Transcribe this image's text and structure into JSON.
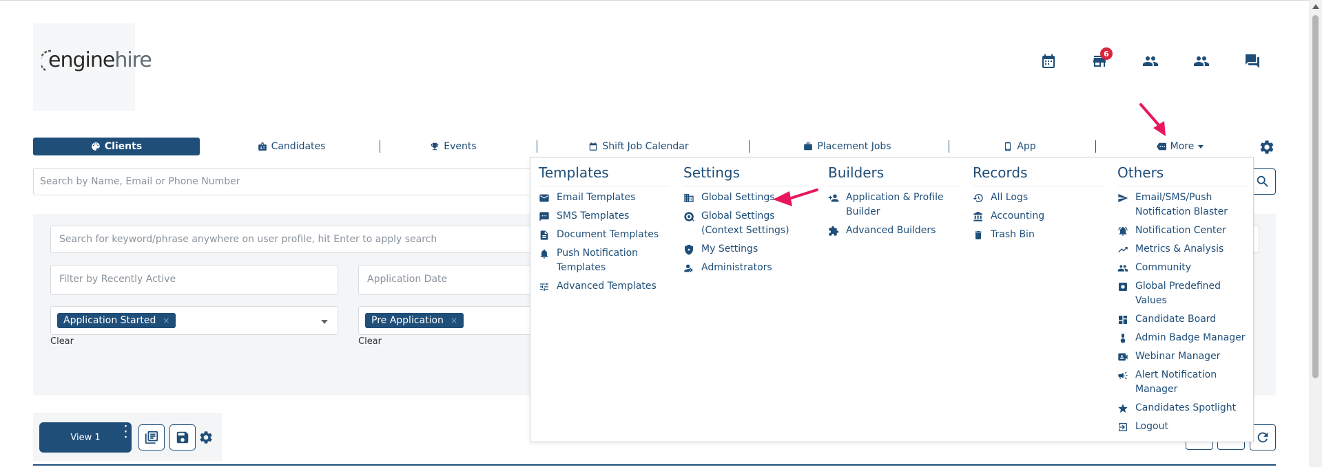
{
  "logo": {
    "text_a": "engine",
    "text_b": "hire"
  },
  "header_icons": [
    {
      "name": "calendar-icon"
    },
    {
      "name": "store-icon",
      "badge": "6"
    },
    {
      "name": "people-icon"
    },
    {
      "name": "group-icon"
    },
    {
      "name": "chat-icon"
    }
  ],
  "nav": {
    "tabs": [
      {
        "label": "Clients",
        "icon": "palette-icon",
        "active": true
      },
      {
        "label": "Candidates",
        "icon": "badge-icon"
      },
      {
        "label": "Events",
        "icon": "trophy-icon"
      },
      {
        "label": "Shift Job Calendar",
        "icon": "calendar-icon"
      },
      {
        "label": "Placement Jobs",
        "icon": "briefcase-icon"
      },
      {
        "label": "App",
        "icon": "phone-icon"
      },
      {
        "label": "More",
        "icon": "more-icon"
      }
    ]
  },
  "search": {
    "placeholder": "Search by Name, Email or Phone Number"
  },
  "filters": {
    "keyword_placeholder": "Search for keyword/phrase anywhere on user profile, hit Enter to apply search",
    "recent_placeholder": "Filter by Recently Active",
    "app_date_placeholder": "Application Date",
    "chip1": "Application Started",
    "chip2": "Pre Application",
    "clear1": "Clear",
    "clear2": "Clear"
  },
  "views": {
    "view1": "View 1"
  },
  "menu": {
    "templates": {
      "title": "Templates",
      "items": [
        "Email Templates",
        "SMS Templates",
        "Document Templates",
        "Push Notification Templates",
        "Advanced Templates"
      ]
    },
    "settings": {
      "title": "Settings",
      "items": [
        "Global Settings",
        "Global Settings (Context Settings)",
        "My Settings",
        "Administrators"
      ]
    },
    "builders": {
      "title": "Builders",
      "items": [
        "Application & Profile Builder",
        "Advanced Builders"
      ]
    },
    "records": {
      "title": "Records",
      "items": [
        "All Logs",
        "Accounting",
        "Trash Bin"
      ]
    },
    "others": {
      "title": "Others",
      "items": [
        "Email/SMS/Push Notification Blaster",
        "Notification Center",
        "Metrics & Analysis",
        "Community",
        "Global Predefined Values",
        "Candidate Board",
        "Admin Badge Manager",
        "Webinar Manager",
        "Alert Notification Manager",
        "Candidates Spotlight",
        "Logout"
      ]
    }
  },
  "colors": {
    "primary": "#1f4e79",
    "badge": "#d7263d",
    "annotation": "#e8175d"
  }
}
